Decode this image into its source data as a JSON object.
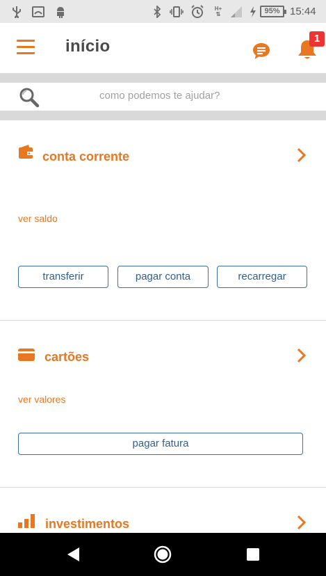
{
  "status_bar": {
    "icons": [
      "usb-icon",
      "cast-icon",
      "android-icon",
      "bluetooth-icon",
      "vibrate-icon",
      "alarm-icon",
      "network-h-plus-icon",
      "signal-icon",
      "charging-icon"
    ],
    "network_type": "H+",
    "battery": "95%",
    "time": "15:44"
  },
  "header": {
    "title": "início",
    "icons": [
      "menu-icon",
      "chat-icon",
      "bell-icon"
    ],
    "notification_count": "1"
  },
  "search": {
    "placeholder": "como podemos te ajudar?",
    "icon": "search-icon"
  },
  "sections": {
    "conta_corrente": {
      "title": "conta corrente",
      "icon": "wallet-icon",
      "link": "ver saldo",
      "buttons": [
        "transferir",
        "pagar conta",
        "recarregar"
      ]
    },
    "cartoes": {
      "title": "cartões",
      "icon": "credit-card-icon",
      "link": "ver valores",
      "button": "pagar fatura"
    },
    "investimentos": {
      "title": "investimentos",
      "icon": "bar-chart-icon"
    }
  },
  "nav_bar": {
    "icons": [
      "back-icon",
      "home-icon",
      "recent-apps-icon"
    ]
  },
  "colors": {
    "accent": "#e87722",
    "button_border": "#3c6f9e",
    "button_text": "#2f5f8f",
    "title_text": "#4a4a4a",
    "separator": "#d9d9d9",
    "status_bar": "#e8e8e8",
    "badge": "#e33333"
  }
}
